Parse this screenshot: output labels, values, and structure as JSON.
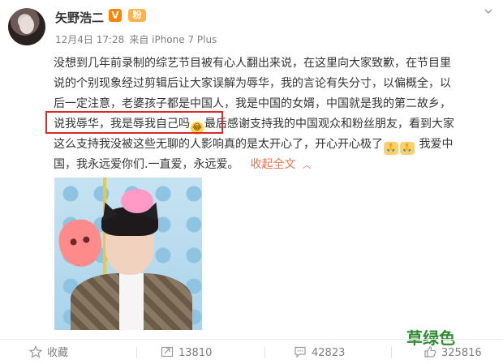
{
  "post": {
    "username": "矢野浩二",
    "vip_badge": "V",
    "fan_badge": "粉",
    "date": "12月4日 17:28",
    "source": "来自 iPhone 7 Plus",
    "lines": [
      "没想到几年前录制的综艺节目被有心人翻出来说，在这里向大家致歉，在节目里",
      "说的个别现象经过剪辑后让大家误解为辱华，我的言论有失分寸，以偏概全，以",
      "后一定注意，老婆孩子都是中国人，我是中国的女婿，中国就是我的第二故乡，",
      "说我辱华，我是辱我自己吗",
      "最后感谢支持我的中国观众和粉丝朋友，看到大家",
      "这么支持我没被这些无聊的人影响真的是太开心了，开心开心极了",
      "我爱中",
      "国，我永远爱你们.一直爱，永远爱。"
    ],
    "collapse_label": "收起全文",
    "emoji_laugh": "😂",
    "emoji_hands": "🙏"
  },
  "actions": {
    "favorite_label": "收藏",
    "repost_count": "13810",
    "comment_count": "42823",
    "like_count": "325816"
  },
  "watermark": "草绿色",
  "icons": [
    "star-icon",
    "repost-icon",
    "comment-icon",
    "like-icon",
    "chevron-down-icon",
    "chevron-up-icon"
  ],
  "colors": {
    "link": "#eb7350",
    "highlight_border": "#d82a2a",
    "watermark": "#2e8b32",
    "meta": "#808080"
  }
}
